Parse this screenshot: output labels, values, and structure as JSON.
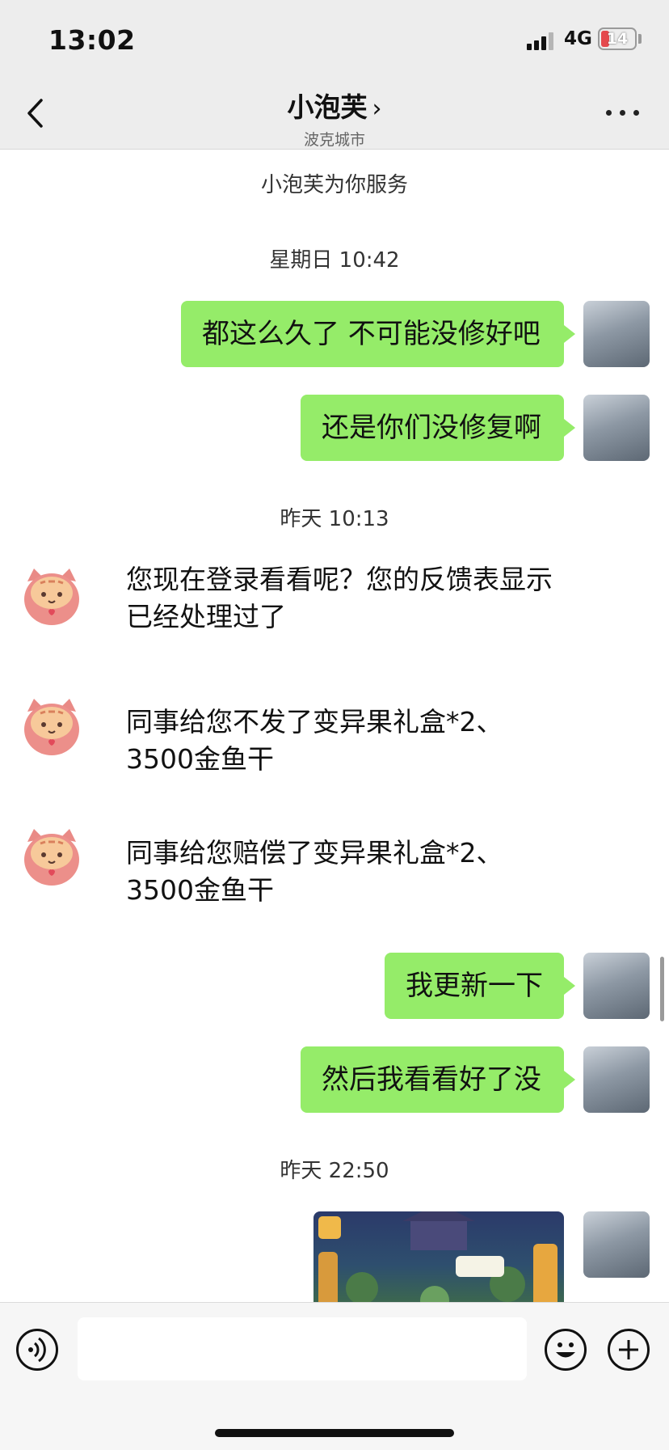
{
  "status_bar": {
    "time": "13:02",
    "network": "4G",
    "battery": "14"
  },
  "header": {
    "title": "小泡芙",
    "title_chevron": "›",
    "subtitle": "波克城市"
  },
  "chat": {
    "service_notice": "小泡芙为你服务",
    "time_1": "星期日 10:42",
    "out_1": "都这么久了 不可能没修好吧",
    "out_2": "还是你们没修复啊",
    "time_2": "昨天 10:13",
    "in_1": "您现在登录看看呢？您的反馈表显示已经处理过了",
    "in_2": "同事给您不发了变异果礼盒*2、3500金鱼干",
    "in_3": "同事给您赔偿了变异果礼盒*2、3500金鱼干",
    "out_3": "我更新一下",
    "out_4": "然后我看看好了没",
    "time_3": "昨天 22:50"
  },
  "input": {
    "value": ""
  },
  "colors": {
    "bubble_out": "#95ec69",
    "chat_bg": "#ffffff",
    "bar_bg": "#ededed"
  },
  "icons": [
    "back-chevron-icon",
    "more-dots-icon",
    "voice-icon",
    "emoji-icon",
    "plus-icon"
  ]
}
